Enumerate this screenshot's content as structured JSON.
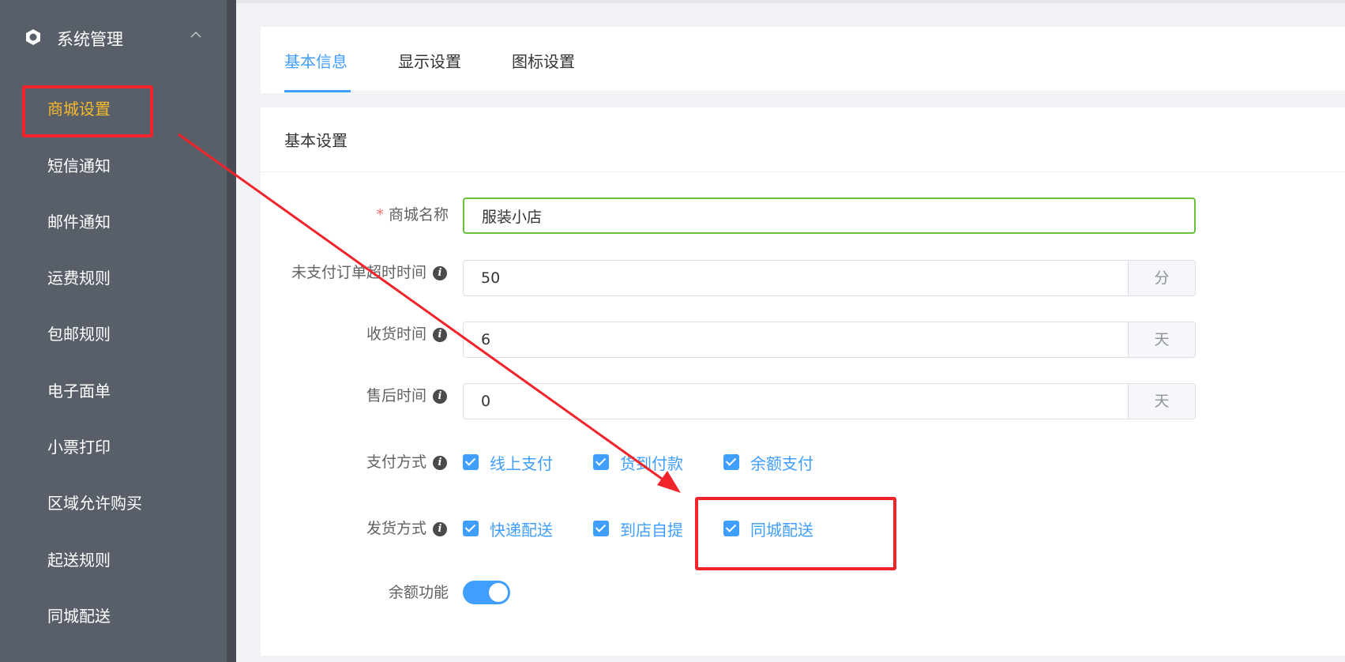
{
  "sidebar": {
    "header_title": "系统管理",
    "items": [
      {
        "label": "商城设置",
        "active": true
      },
      {
        "label": "短信通知"
      },
      {
        "label": "邮件通知"
      },
      {
        "label": "运费规则"
      },
      {
        "label": "包邮规则"
      },
      {
        "label": "电子面单"
      },
      {
        "label": "小票打印"
      },
      {
        "label": "区域允许购买"
      },
      {
        "label": "起送规则"
      },
      {
        "label": "同城配送"
      }
    ]
  },
  "tabs": [
    {
      "label": "基本信息",
      "active": true
    },
    {
      "label": "显示设置"
    },
    {
      "label": "图标设置"
    }
  ],
  "form": {
    "section_title": "基本设置",
    "shop_name": {
      "label": "商城名称",
      "required": "*",
      "value": "服装小店"
    },
    "unpaid_timeout": {
      "label": "未支付订单超时时间",
      "value": "50",
      "unit": "分"
    },
    "receive_time": {
      "label": "收货时间",
      "value": "6",
      "unit": "天"
    },
    "aftersale_time": {
      "label": "售后时间",
      "value": "0",
      "unit": "天"
    },
    "payment": {
      "label": "支付方式",
      "options": [
        {
          "label": "线上支付",
          "checked": true
        },
        {
          "label": "货到付款",
          "checked": true
        },
        {
          "label": "余额支付",
          "checked": true
        }
      ]
    },
    "delivery": {
      "label": "发货方式",
      "options": [
        {
          "label": "快递配送",
          "checked": true
        },
        {
          "label": "到店自提",
          "checked": true
        },
        {
          "label": "同城配送",
          "checked": true
        }
      ]
    },
    "balance": {
      "label": "余额功能",
      "enabled": true
    }
  },
  "icons": {
    "info": "i",
    "menu_header": "hexagon-icon",
    "collapse": "chevron-up-icon"
  },
  "colors": {
    "sidebar_bg": "#595f69",
    "accent": "#409eff",
    "active_menu": "#f7ba2a",
    "annotation_red": "#f2242b",
    "focus_border": "#67c23a"
  }
}
